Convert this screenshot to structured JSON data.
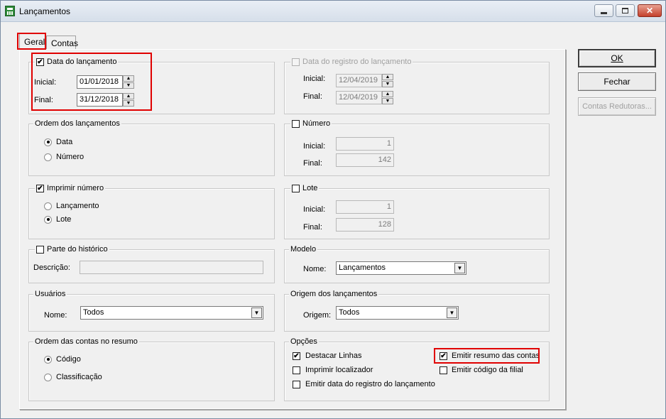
{
  "window": {
    "title": "Lançamentos"
  },
  "tabs": [
    {
      "label": "Geral",
      "selected": true
    },
    {
      "label": "Contas",
      "selected": false
    }
  ],
  "data_lancamento": {
    "label": "Data do lançamento",
    "checked": true,
    "inicial_label": "Inicial:",
    "inicial_value": "01/01/2018",
    "final_label": "Final:",
    "final_value": "31/12/2018"
  },
  "data_registro": {
    "label": "Data do registro do lançamento",
    "checked": false,
    "inicial_label": "Inicial:",
    "inicial_value": "12/04/2019",
    "final_label": "Final:",
    "final_value": "12/04/2019"
  },
  "ordem_lancamentos": {
    "label": "Ordem dos lançamentos",
    "options": [
      "Data",
      "Número"
    ],
    "selected": "Data"
  },
  "numero": {
    "label": "Número",
    "checked": false,
    "inicial_label": "Inicial:",
    "inicial_value": "1",
    "final_label": "Final:",
    "final_value": "142"
  },
  "imprimir_numero": {
    "label": "Imprimir número",
    "checked": true,
    "options": [
      "Lançamento",
      "Lote"
    ],
    "selected": "Lote"
  },
  "lote": {
    "label": "Lote",
    "checked": false,
    "inicial_label": "Inicial:",
    "inicial_value": "1",
    "final_label": "Final:",
    "final_value": "128"
  },
  "parte_historico": {
    "label": "Parte do histórico",
    "checked": false,
    "descricao_label": "Descrição:",
    "descricao_value": ""
  },
  "modelo": {
    "label": "Modelo",
    "nome_label": "Nome:",
    "nome_value": "Lançamentos"
  },
  "usuarios": {
    "label": "Usuários",
    "nome_label": "Nome:",
    "nome_value": "Todos"
  },
  "origem": {
    "label": "Origem dos lançamentos",
    "origem_label": "Origem:",
    "origem_value": "Todos"
  },
  "ordem_contas": {
    "label": "Ordem das contas no resumo",
    "options": [
      "Código",
      "Classificação"
    ],
    "selected": "Código"
  },
  "opcoes": {
    "label": "Opções",
    "items": [
      {
        "label": "Destacar Linhas",
        "checked": true
      },
      {
        "label": "Imprimir localizador",
        "checked": false
      },
      {
        "label": "Emitir data do registro do lançamento",
        "checked": false
      },
      {
        "label": "Emitir resumo das contas",
        "checked": true
      },
      {
        "label": "Emitir código da filial",
        "checked": false
      }
    ]
  },
  "buttons": {
    "ok": "OK",
    "fechar": "Fechar",
    "contas_redutoras": "Contas Redutoras..."
  },
  "glyphs": {
    "check": "✔",
    "up": "▲",
    "down": "▼",
    "close": "✕"
  }
}
